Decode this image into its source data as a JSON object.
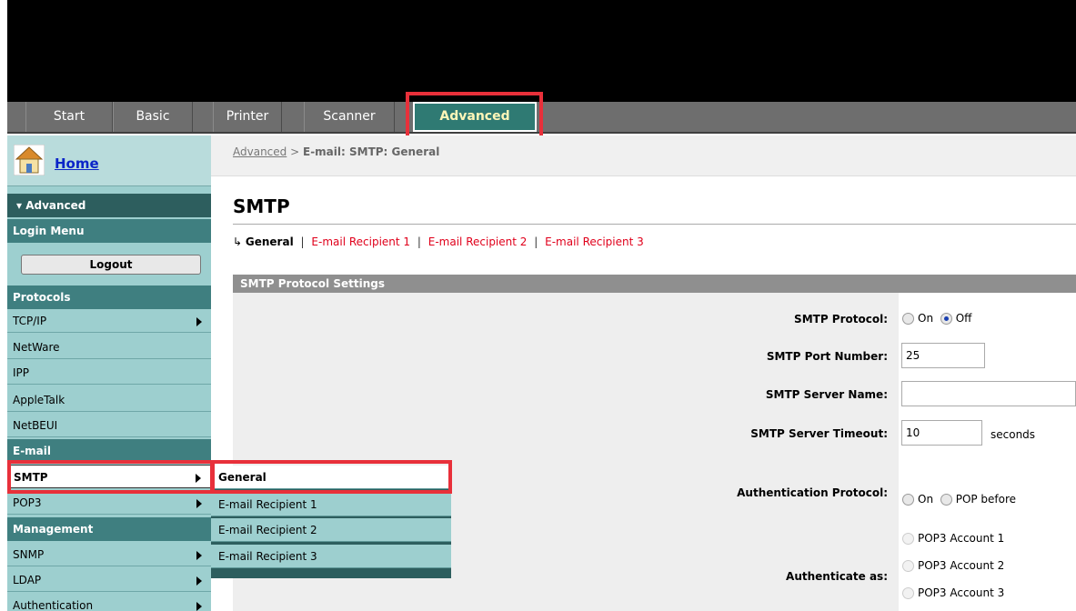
{
  "tabs": [
    "Start",
    "Basic",
    "Printer",
    "Scanner",
    "Advanced"
  ],
  "sidebar": {
    "home_label": "Home",
    "advanced_header": "▾ Advanced",
    "login_menu": "Login Menu",
    "logout_label": "Logout",
    "protocols_header": "Protocols",
    "protocols": [
      "TCP/IP",
      "NetWare",
      "IPP",
      "AppleTalk",
      "NetBEUI"
    ],
    "email_header": "E-mail",
    "email_items": [
      "SMTP",
      "POP3"
    ],
    "management_header": "Management",
    "management_items": [
      "SNMP",
      "LDAP",
      "Authentication"
    ]
  },
  "flyout": [
    "General",
    "E-mail Recipient 1",
    "E-mail Recipient 2",
    "E-mail Recipient 3"
  ],
  "breadcrumb": {
    "link": "Advanced",
    "separator": ">",
    "current": "E-mail: SMTP: General"
  },
  "page_title": "SMTP",
  "sublinks": {
    "current": "General",
    "links": [
      "E-mail Recipient 1",
      "E-mail Recipient 2",
      "E-mail Recipient 3"
    ]
  },
  "section_title": "SMTP Protocol Settings",
  "form": {
    "smtp_protocol_label": "SMTP Protocol:",
    "smtp_protocol_on": "On",
    "smtp_protocol_off": "Off",
    "port_label": "SMTP Port Number:",
    "port_value": "25",
    "server_name_label": "SMTP Server Name:",
    "server_name_value": "",
    "timeout_label": "SMTP Server Timeout:",
    "timeout_value": "10",
    "timeout_unit": "seconds",
    "auth_protocol_label": "Authentication Protocol:",
    "auth_on": "On",
    "auth_pop_before": "POP before",
    "auth_as_label": "Authenticate as:",
    "auth_as_options": [
      "POP3 Account 1",
      "POP3 Account 2",
      "POP3 Account 3"
    ]
  },
  "colors": {
    "highlight": "#e8303a",
    "sidebar": "#9dcfcf",
    "active_tab": "#2f7a73",
    "link_red": "#e0001b"
  }
}
